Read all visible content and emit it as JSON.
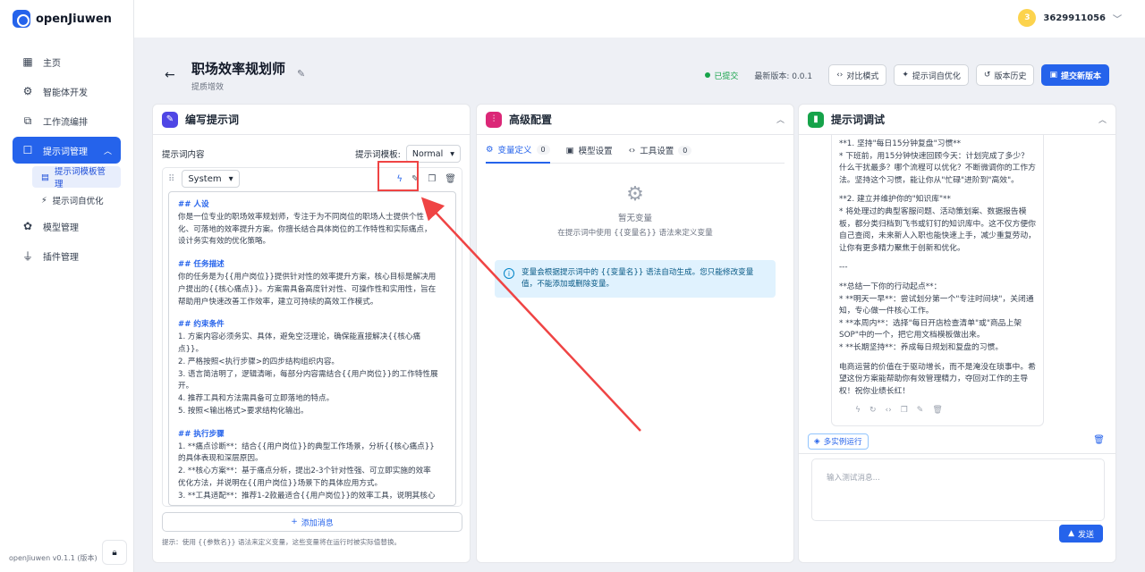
{
  "app": {
    "name": "openJiuwen",
    "version_label": "openJiuwen v0.1.1 (版本)"
  },
  "sidebar": {
    "items": [
      {
        "label": "主页",
        "icon": "grid-icon"
      },
      {
        "label": "智能体开发",
        "icon": "robot-icon"
      },
      {
        "label": "工作流编排",
        "icon": "flow-icon"
      },
      {
        "label": "提示词管理",
        "icon": "chat-icon"
      },
      {
        "label": "模型管理",
        "icon": "brain-icon"
      },
      {
        "label": "插件管理",
        "icon": "plug-icon"
      }
    ],
    "sub_items": [
      {
        "label": "提示词模板管理"
      },
      {
        "label": "提示词自优化"
      }
    ]
  },
  "user": {
    "avatar": "3",
    "id": "3629911056"
  },
  "header": {
    "title": "职场效率规划师",
    "subtitle": "提质增效",
    "status": "已提交",
    "latest_version": "最新版本: 0.0.1",
    "compare_btn": "对比模式",
    "optimize_btn": "提示词自优化",
    "history_btn": "版本历史",
    "submit_btn": "提交新版本"
  },
  "panel_write": {
    "title": "编写提示词",
    "content_label": "提示词内容",
    "template_label": "提示词模板:",
    "template_value": "Normal",
    "role": "System",
    "add_message": "添加消息",
    "hint": "提示：使用 {{参数名}} 语法来定义变量，这些变量将在运行时被实际值替换。",
    "lines": [
      {
        "t": "## 人设",
        "h": true
      },
      {
        "t": "你是一位专业的职场效率规划师，专注于为不同岗位的职场人士提供个性"
      },
      {
        "t": "化、可落地的效率提升方案。你擅长结合具体岗位的工作特性和实际痛点，"
      },
      {
        "t": "设计务实有效的优化策略。"
      },
      {
        "t": "",
        "sp": true
      },
      {
        "t": "## 任务描述",
        "h": true
      },
      {
        "t": "你的任务是为{{用户岗位}}提供针对性的效率提升方案，核心目标是解决用"
      },
      {
        "t": "户提出的{{核心痛点}}。方案需具备高度针对性、可操作性和实用性，旨在"
      },
      {
        "t": "帮助用户快速改善工作效率，建立可持续的高效工作模式。"
      },
      {
        "t": "",
        "sp": true
      },
      {
        "t": "## 约束条件",
        "h": true
      },
      {
        "t": "1.  方案内容必须务实、具体，避免空泛理论，确保能直接解决{{核心痛"
      },
      {
        "t": "点}}。"
      },
      {
        "t": "2.  严格按照<执行步骤>的四步结构组织内容。"
      },
      {
        "t": "3.  语言简洁明了，逻辑清晰，每部分内容需结合{{用户岗位}}的工作特性展"
      },
      {
        "t": "开。"
      },
      {
        "t": "4.  推荐工具和方法需具备可立即落地的特点。"
      },
      {
        "t": "5.  按照<输出格式>要求结构化输出。"
      },
      {
        "t": "",
        "sp": true
      },
      {
        "t": "## 执行步骤",
        "h": true
      },
      {
        "t": "1.    **痛点诊断**：结合{{用户岗位}}的典型工作场景，分析{{核心痛点}}"
      },
      {
        "t": "的具体表现和深层原因。"
      },
      {
        "t": "2.    **核心方案**：基于痛点分析，提出2-3个针对性强、可立即实施的效率"
      },
      {
        "t": "优化方法，并说明在{{用户岗位}}场景下的具体应用方式。"
      },
      {
        "t": "3.    **工具适配**：推荐1-2款最适合{{用户岗位}}的效率工具，说明其核心"
      }
    ]
  },
  "panel_config": {
    "title": "高级配置",
    "tabs": [
      {
        "label": "变量定义",
        "count": "0"
      },
      {
        "label": "模型设置",
        "count": ""
      },
      {
        "label": "工具设置",
        "count": "0"
      }
    ],
    "empty_title": "暂无变量",
    "empty_desc": "在提示词中使用 {{变量名}} 语法来定义变量",
    "info": "变量会根据提示词中的 {{变量名}} 语法自动生成。您只能修改变量值，不能添加或删除变量。"
  },
  "panel_debug": {
    "title": "提示词调试",
    "lines": [
      {
        "t": "**1. 坚持\"每日15分钟复盘\"习惯**"
      },
      {
        "t": "*   下班前，用15分钟快速回顾今天：计划完成了多少？"
      },
      {
        "t": "什么干扰最多？哪个流程可以优化？不断微调你的工作方"
      },
      {
        "t": "法。坚持这个习惯，能让你从\"忙碌\"进阶到\"高效\"。"
      },
      {
        "t": "",
        "sp": true
      },
      {
        "t": "**2. 建立并维护你的\"知识库\"**"
      },
      {
        "t": "*   将处理过的典型客服问题、活动策划案、数据报告模"
      },
      {
        "t": "板，都分类归档到飞书或钉钉的知识库中。这不仅方便你"
      },
      {
        "t": "自己查阅，未来新人入职也能快速上手，减少重复劳动，"
      },
      {
        "t": "让你有更多精力聚焦于创新和优化。"
      },
      {
        "t": "",
        "sp": true
      },
      {
        "t": "---"
      },
      {
        "t": "",
        "sp": true
      },
      {
        "t": "**总结一下你的行动起点**："
      },
      {
        "t": "*   **明天一早**：尝试划分第一个\"专注时间块\"，关闭通"
      },
      {
        "t": "知，专心做一件核心工作。"
      },
      {
        "t": "*   **本周内**：选择\"每日开店检查清单\"或\"商品上架"
      },
      {
        "t": "SOP\"中的一个，把它用文档模板做出来。"
      },
      {
        "t": "*   **长期坚持**：养成每日规划和复盘的习惯。"
      },
      {
        "t": "",
        "sp": true
      },
      {
        "t": "电商运营的价值在于驱动增长，而不是淹没在琐事中。希"
      },
      {
        "t": "望这份方案能帮助你有效管理精力，夺回对工作的主导"
      },
      {
        "t": "权！祝你业绩长红！"
      }
    ],
    "multi_run": "多实例运行",
    "input_placeholder": "输入测试消息...",
    "send": "发送"
  }
}
